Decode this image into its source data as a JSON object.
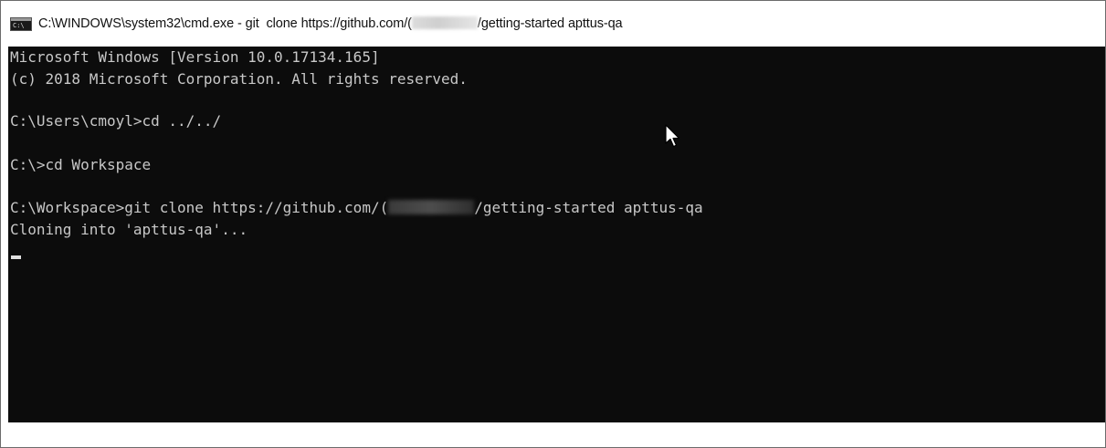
{
  "window": {
    "title_prefix": "C:\\WINDOWS\\system32\\cmd.exe - git  clone https://github.com/(",
    "title_suffix": "/getting-started apttus-qa",
    "icon": "console-icon",
    "icon_text": "C:\\"
  },
  "console": {
    "line1": "Microsoft Windows [Version 10.0.17134.165]",
    "line2": "(c) 2018 Microsoft Corporation. All rights reserved.",
    "line3": "C:\\Users\\cmoyl>cd ../../",
    "line4": "C:\\>cd Workspace",
    "line5_prefix": "C:\\Workspace>git clone https://github.com/(",
    "line5_suffix": "/getting-started apttus-qa",
    "line6": "Cloning into 'apttus-qa'..."
  },
  "colors": {
    "console_bg": "#0c0c0c",
    "console_text": "#c8c8c8",
    "titlebar_bg": "#ffffff"
  },
  "icons": [
    "console-icon",
    "mouse-pointer-icon",
    "text-cursor"
  ]
}
